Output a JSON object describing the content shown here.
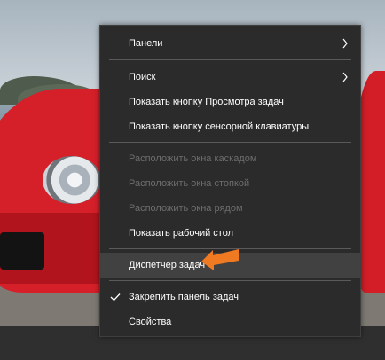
{
  "colors": {
    "menu_background": "#2b2b2b",
    "menu_text": "#ffffff",
    "disabled_text": "#6d6d6d",
    "highlight_background": "#414141",
    "arrow_accent": "#f07a22"
  },
  "context_menu": {
    "items": [
      {
        "label": "Панели",
        "submenu": true,
        "enabled": true
      },
      {
        "label": "Поиск",
        "submenu": true,
        "enabled": true
      },
      {
        "label": "Показать кнопку Просмотра задач",
        "enabled": true
      },
      {
        "label": "Показать кнопку сенсорной клавиатуры",
        "enabled": true
      },
      {
        "label": "Расположить окна каскадом",
        "enabled": false
      },
      {
        "label": "Расположить окна стопкой",
        "enabled": false
      },
      {
        "label": "Расположить окна рядом",
        "enabled": false
      },
      {
        "label": "Показать рабочий стол",
        "enabled": true
      },
      {
        "label": "Диспетчер задач",
        "enabled": true,
        "highlighted": true
      },
      {
        "label": "Закрепить панель задач",
        "enabled": true,
        "checked": true
      },
      {
        "label": "Свойства",
        "enabled": true
      }
    ]
  },
  "icons": {
    "submenu": "chevron-right-icon",
    "checked": "checkmark-icon",
    "annotation": "orange-arrow-icon"
  }
}
